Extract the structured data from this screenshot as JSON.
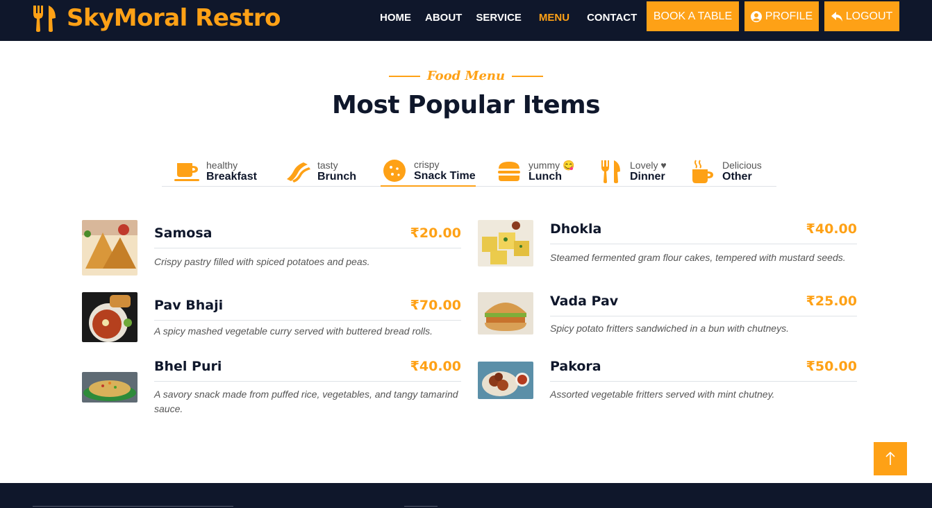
{
  "brand": {
    "name": "SkyMoral Restro",
    "icon": "utensils-icon"
  },
  "nav": {
    "links": [
      "HOME",
      "ABOUT",
      "SERVICE",
      "MENU",
      "CONTACT"
    ],
    "active": "MENU",
    "book_label": "BOOK A TABLE",
    "profile_label": "PROFILE",
    "logout_label": "LOGOUT"
  },
  "header": {
    "tag": "Food Menu",
    "title": "Most Popular Items"
  },
  "tabs": [
    {
      "sub": "healthy",
      "main": "Breakfast",
      "icon": "coffee-cup-icon"
    },
    {
      "sub": "tasty",
      "main": "Brunch",
      "icon": "bacon-icon"
    },
    {
      "sub": "crispy",
      "main": "Snack Time",
      "icon": "cookie-icon"
    },
    {
      "sub": "yummy 😋",
      "main": "Lunch",
      "icon": "burger-icon"
    },
    {
      "sub": "Lovely ♥",
      "main": "Dinner",
      "icon": "utensils-icon"
    },
    {
      "sub": "Delicious",
      "main": "Other",
      "icon": "mug-hot-icon"
    }
  ],
  "active_tab": "Snack Time",
  "items": [
    {
      "name": "Samosa",
      "price": "₹20.00",
      "desc": "Crispy pastry filled with spiced potatoes and peas."
    },
    {
      "name": "Dhokla",
      "price": "₹40.00",
      "desc": "Steamed fermented gram flour cakes, tempered with mustard seeds."
    },
    {
      "name": "Pav Bhaji",
      "price": "₹70.00",
      "desc": "A spicy mashed vegetable curry served with buttered bread rolls."
    },
    {
      "name": "Vada Pav",
      "price": "₹25.00",
      "desc": "Spicy potato fritters sandwiched in a bun with chutneys."
    },
    {
      "name": "Bhel Puri",
      "price": "₹40.00",
      "desc": "A savory snack made from puffed rice, vegetables, and tangy tamarind sauce."
    },
    {
      "name": "Pakora",
      "price": "₹50.00",
      "desc": "Assorted vegetable fritters served with mint chutney."
    }
  ],
  "colors": {
    "primary": "#fea116",
    "dark": "#0f172b",
    "text_muted": "#555555",
    "border": "#dee2e6"
  }
}
